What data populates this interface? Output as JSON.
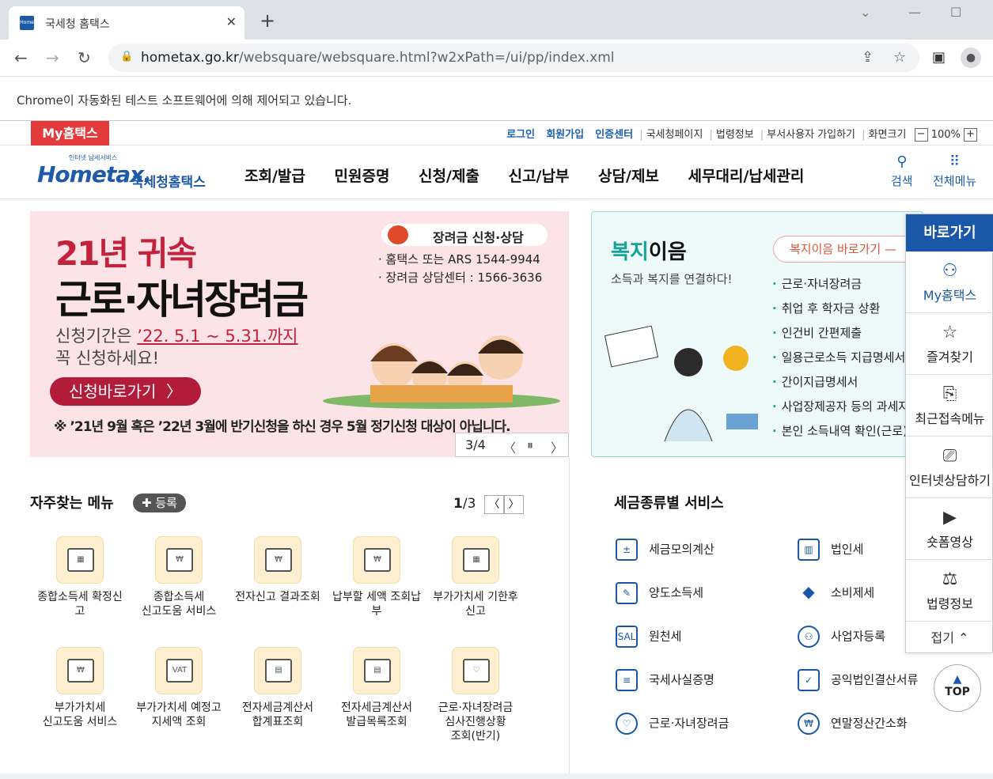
{
  "browser": {
    "tab_title": "국세청 홈택스",
    "url_host": "hometax.go.kr",
    "url_path": "/websquare/websquare.html?w2xPath=/ui/pp/index.xml",
    "automation_banner": "Chrome이 자동화된 테스트 소프트웨어에 의해 제어되고 있습니다."
  },
  "util": {
    "my_hometax": "My홈택스",
    "login": "로그인",
    "signup": "회원가입",
    "cert": "인증센터",
    "nts_page": "국세청페이지",
    "law": "법령정보",
    "dept_signup": "부서사용자 가입하기",
    "screen_size": "화면크기",
    "zoom": "100%"
  },
  "header": {
    "logo_small": "인터넷 납세서비스",
    "logo_big": "Hometax.",
    "logo_kr": "국세청홈택스",
    "gnb": [
      "조회/발급",
      "민원증명",
      "신청/제출",
      "신고/납부",
      "상담/제보",
      "세무대리/납세관리"
    ],
    "search": "검색",
    "all_menu": "전체메뉴"
  },
  "hero": {
    "line1": "21년 귀속",
    "line2": "근로·자녀장려금",
    "period_prefix": "신청기간은",
    "period": "’22. 5.1 ~ 5.31.까지",
    "period2": "꼭 신청하세요!",
    "button": "신청바로가기",
    "note": "※ ’21년 9월 혹은 ’22년 3월에 반기신청을 하신 경우 5월 정기신청 대상이 아닙니다.",
    "contact_title": "장려금 신청·상담",
    "contact1": "· 홈택스 또는  ARS 1544-9944",
    "contact2": "· 장려금 상담센터 : 1566-3636",
    "counter": "3/4"
  },
  "welfare": {
    "title_a": "복지",
    "title_b": "이음",
    "subtitle": "소득과 복지를 연결하다!",
    "button": "복지이음 바로가기",
    "items": [
      "근로·자녀장려금",
      "취업 후 학자금 상환",
      "인건비 간편제출",
      "일용근로소득 지급명세서",
      "간이지급명세서",
      "사업장제공자 등의 과세자료",
      "본인 소득내역 확인(근로)"
    ]
  },
  "quick": {
    "title": "바로가기",
    "items": [
      "My홈택스",
      "즐겨찾기",
      "최근접속메뉴",
      "인터넷상담하기",
      "숏폼영상",
      "법령정보"
    ],
    "fold": "접기",
    "top": "TOP"
  },
  "favorites": {
    "title": "자주찾는 메뉴",
    "register": "등록",
    "page_current": "1",
    "page_total": "/3",
    "items": [
      [
        "종합소득세 확정신",
        "고"
      ],
      [
        "종합소득세",
        "신고도움 서비스"
      ],
      [
        "전자신고 결과조회",
        ""
      ],
      [
        "납부할 세액 조회납",
        "부"
      ],
      [
        "부가가치세 기한후",
        "신고"
      ],
      [
        "부가가치세",
        "신고도움 서비스"
      ],
      [
        "부가가치세 예정고",
        "지세액 조회"
      ],
      [
        "전자세금계산서",
        "합계표조회"
      ],
      [
        "전자세금계산서",
        "발급목록조회"
      ],
      [
        "근로·자녀장려금",
        "심사진행상황",
        "조회(반기)"
      ]
    ]
  },
  "tax": {
    "title": "세금종류별 서비스",
    "left": [
      "세금모의계산",
      "양도소득세",
      "원천세",
      "국세사실증명",
      "근로·자녀장려금"
    ],
    "right": [
      "법인세",
      "소비제세",
      "사업자등록",
      "공익법인결산서류",
      "연말정산간소화"
    ]
  }
}
